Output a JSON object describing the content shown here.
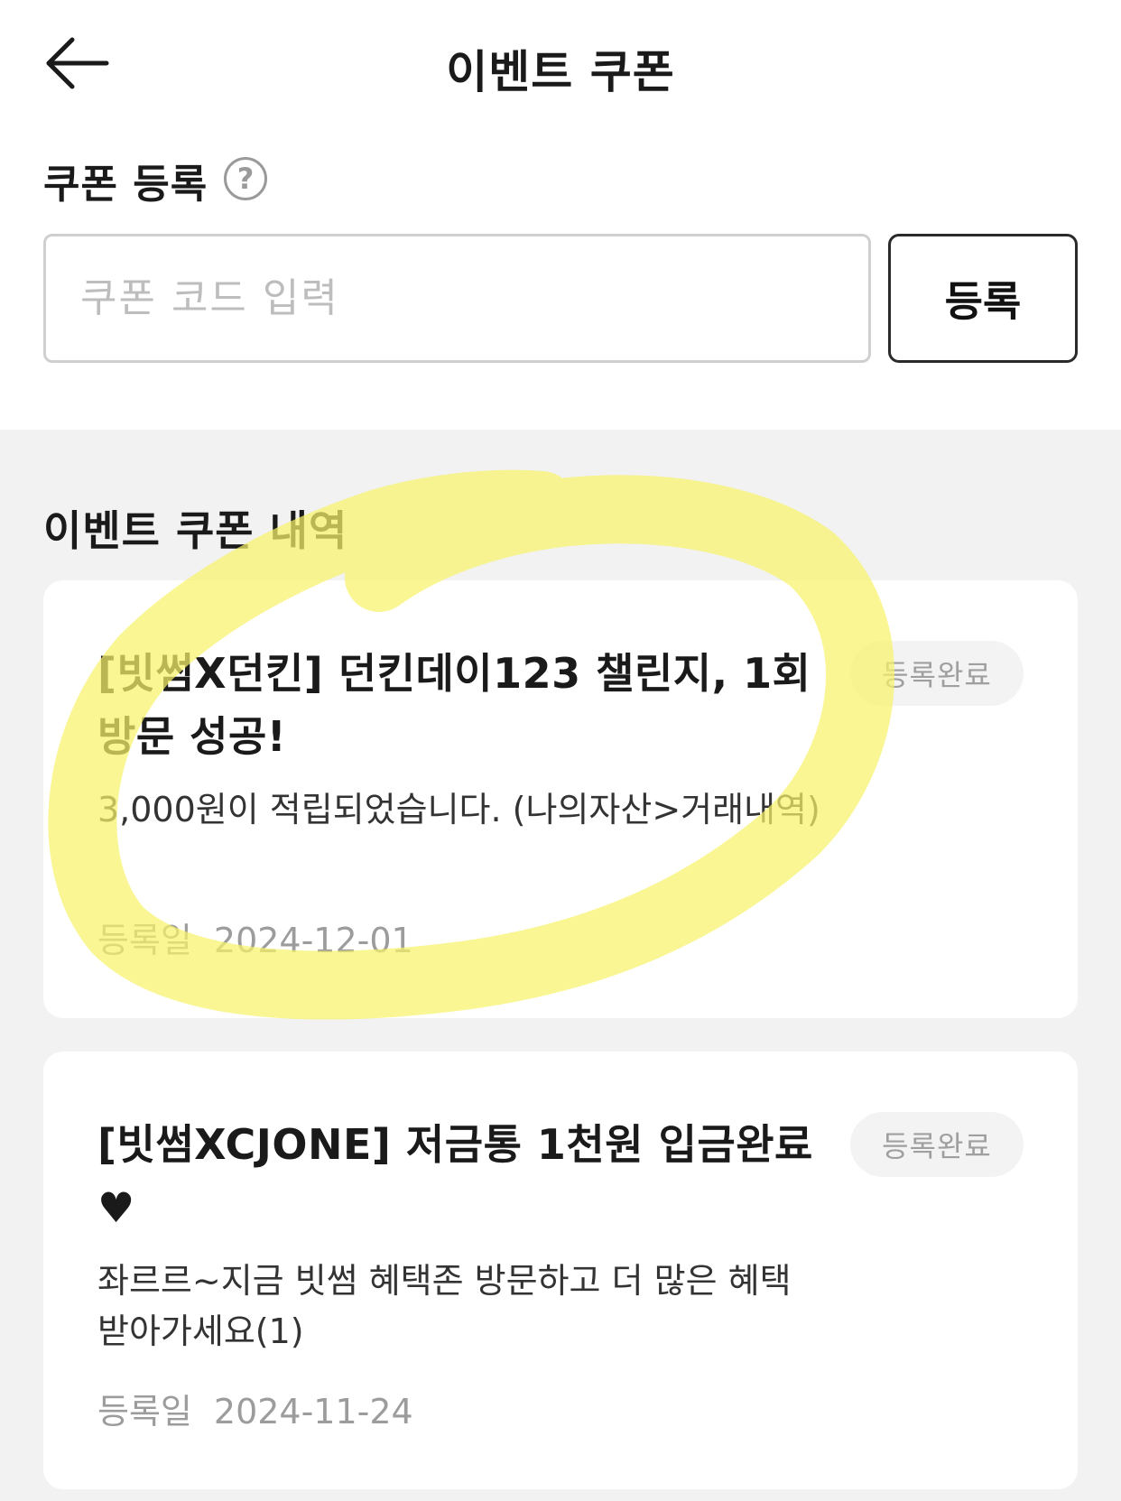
{
  "header": {
    "title": "이벤트 쿠폰"
  },
  "register": {
    "label": "쿠폰 등록",
    "help_icon": "?",
    "input_placeholder": "쿠폰 코드 입력",
    "input_value": "",
    "button_label": "등록"
  },
  "history": {
    "title": "이벤트 쿠폰 내역",
    "items": [
      {
        "title": "[빗썸X던킨] 던킨데이123 챌린지, 1회방문 성공!",
        "description": "3,000원이 적립되었습니다. (나의자산>거래내역)",
        "date_label": "등록일",
        "date": "2024-12-01",
        "status": "등록완료"
      },
      {
        "title": "[빗썸XCJONE] 저금통 1천원 입금완료♥",
        "description": "좌르르~지금 빗썸 혜택존 방문하고 더 많은 혜택 받아가세요(1)",
        "date_label": "등록일",
        "date": "2024-11-24",
        "status": "등록완료"
      }
    ]
  },
  "colors": {
    "highlight": "#f7f26a",
    "background": "#f2f2f2",
    "card": "#ffffff",
    "muted_text": "#9c9c9c"
  },
  "icons": {
    "back": "arrow-left-icon",
    "help": "question-circle-icon"
  }
}
